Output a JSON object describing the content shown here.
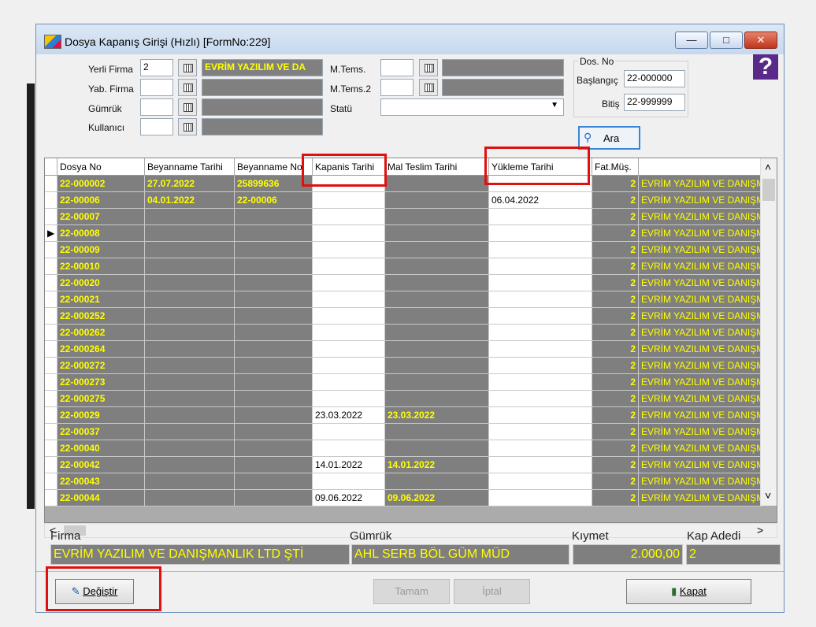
{
  "window": {
    "title": "Dosya Kapanış Girişi (Hızlı) [FormNo:229]",
    "min": "—",
    "max": "□",
    "close": "✕"
  },
  "filters": {
    "yerli_firma_label": "Yerli Firma",
    "yerli_firma_code": "2",
    "yerli_firma_name": "EVRİM YAZILIM VE DA",
    "yab_firma_label": "Yab. Firma",
    "gumruk_label": "Gümrük",
    "kullanici_label": "Kullanıcı",
    "mtems_label": "M.Tems.",
    "mtems2_label": "M.Tems.2",
    "statu_label": "Statü",
    "dosno_group": "Dos. No",
    "baslangic_label": "Başlangıç",
    "baslangic_value": "22-000000",
    "bitis_label": "Bitiş",
    "bitis_value": "22-999999",
    "help": "?",
    "ara_label": "Ara"
  },
  "grid": {
    "headers": [
      "Dosya No",
      "Beyanname Tarihi",
      "Beyanname No",
      "Kapanis Tarihi",
      "Mal Teslim Tarihi",
      "Yükleme Tarihi",
      "Fat.Müş.",
      ""
    ],
    "rows": [
      {
        "no": "22-000002",
        "btarih": "27.07.2022",
        "bno": "25899636",
        "kap": "",
        "mal": "",
        "yuk": "",
        "fat": "2",
        "firma": "EVRİM YAZILIM VE DANIŞMANLIK"
      },
      {
        "no": "22-00006",
        "btarih": "04.01.2022",
        "bno": "22-00006",
        "kap": "",
        "mal": "",
        "yuk": "06.04.2022",
        "fat": "2",
        "firma": "EVRİM YAZILIM VE DANIŞMANLIK"
      },
      {
        "no": "22-00007",
        "btarih": "",
        "bno": "",
        "kap": "",
        "mal": "",
        "yuk": "",
        "fat": "2",
        "firma": "EVRİM YAZILIM VE DANIŞMANLIK"
      },
      {
        "no": "22-00008",
        "btarih": "",
        "bno": "",
        "kap": "",
        "mal": "",
        "yuk": "",
        "fat": "2",
        "firma": "EVRİM YAZILIM VE DANIŞMANLIK"
      },
      {
        "no": "22-00009",
        "btarih": "",
        "bno": "",
        "kap": "",
        "mal": "",
        "yuk": "",
        "fat": "2",
        "firma": "EVRİM YAZILIM VE DANIŞMANLIK"
      },
      {
        "no": "22-00010",
        "btarih": "",
        "bno": "",
        "kap": "",
        "mal": "",
        "yuk": "",
        "fat": "2",
        "firma": "EVRİM YAZILIM VE DANIŞMANLIK"
      },
      {
        "no": "22-00020",
        "btarih": "",
        "bno": "",
        "kap": "",
        "mal": "",
        "yuk": "",
        "fat": "2",
        "firma": "EVRİM YAZILIM VE DANIŞMANLIK"
      },
      {
        "no": "22-00021",
        "btarih": "",
        "bno": "",
        "kap": "",
        "mal": "",
        "yuk": "",
        "fat": "2",
        "firma": "EVRİM YAZILIM VE DANIŞMANLIK"
      },
      {
        "no": "22-000252",
        "btarih": "",
        "bno": "",
        "kap": "",
        "mal": "",
        "yuk": "",
        "fat": "2",
        "firma": "EVRİM YAZILIM VE DANIŞMANLIK"
      },
      {
        "no": "22-000262",
        "btarih": "",
        "bno": "",
        "kap": "",
        "mal": "",
        "yuk": "",
        "fat": "2",
        "firma": "EVRİM YAZILIM VE DANIŞMANLIK"
      },
      {
        "no": "22-000264",
        "btarih": "",
        "bno": "",
        "kap": "",
        "mal": "",
        "yuk": "",
        "fat": "2",
        "firma": "EVRİM YAZILIM VE DANIŞMANLIK"
      },
      {
        "no": "22-000272",
        "btarih": "",
        "bno": "",
        "kap": "",
        "mal": "",
        "yuk": "",
        "fat": "2",
        "firma": "EVRİM YAZILIM VE DANIŞMANLIK"
      },
      {
        "no": "22-000273",
        "btarih": "",
        "bno": "",
        "kap": "",
        "mal": "",
        "yuk": "",
        "fat": "2",
        "firma": "EVRİM YAZILIM VE DANIŞMANLIK"
      },
      {
        "no": "22-000275",
        "btarih": "",
        "bno": "",
        "kap": "",
        "mal": "",
        "yuk": "",
        "fat": "2",
        "firma": "EVRİM YAZILIM VE DANIŞMANLIK"
      },
      {
        "no": "22-00029",
        "btarih": "",
        "bno": "",
        "kap": "23.03.2022",
        "mal": "23.03.2022",
        "yuk": "",
        "fat": "2",
        "firma": "EVRİM YAZILIM VE DANIŞMANLIK"
      },
      {
        "no": "22-00037",
        "btarih": "",
        "bno": "",
        "kap": "",
        "mal": "",
        "yuk": "",
        "fat": "2",
        "firma": "EVRİM YAZILIM VE DANIŞMANLIK"
      },
      {
        "no": "22-00040",
        "btarih": "",
        "bno": "",
        "kap": "",
        "mal": "",
        "yuk": "",
        "fat": "2",
        "firma": "EVRİM YAZILIM VE DANIŞMANLIK"
      },
      {
        "no": "22-00042",
        "btarih": "",
        "bno": "",
        "kap": "14.01.2022",
        "mal": "14.01.2022",
        "yuk": "",
        "fat": "2",
        "firma": "EVRİM YAZILIM VE DANIŞMANLIK"
      },
      {
        "no": "22-00043",
        "btarih": "",
        "bno": "",
        "kap": "",
        "mal": "",
        "yuk": "",
        "fat": "2",
        "firma": "EVRİM YAZILIM VE DANIŞMANLIK"
      },
      {
        "no": "22-00044",
        "btarih": "",
        "bno": "",
        "kap": "09.06.2022",
        "mal": "09.06.2022",
        "yuk": "",
        "fat": "2",
        "firma": "EVRİM YAZILIM VE DANIŞMANLIK"
      }
    ],
    "current_row_marker": "▶"
  },
  "summary": {
    "firma_label": "Firma",
    "firma_value": "EVRİM YAZILIM VE DANIŞMANLIK LTD ŞTİ",
    "gumruk_label": "Gümrük",
    "gumruk_value": "AHL SERB BÖL GÜM MÜD",
    "kiymet_label": "Kıymet",
    "kiymet_value": "2.000,00",
    "kap_label": "Kap Adedi",
    "kap_value": "2"
  },
  "buttons": {
    "degistir": "Değiştir",
    "tamam": "Tamam",
    "iptal": "İptal",
    "kapat": "Kapat"
  },
  "scroll": {
    "up": "˄",
    "down": "˅",
    "left": "<",
    "right": ">"
  }
}
